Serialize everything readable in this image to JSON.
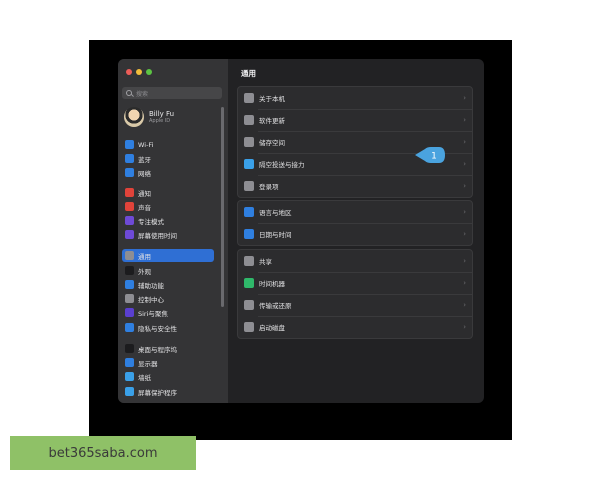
{
  "window": {
    "sidebar": {
      "search_placeholder": "搜索",
      "profile": {
        "name": "Billy Fu",
        "subtitle": "Apple ID"
      },
      "items": [
        {
          "label": "Wi-Fi",
          "icon": "wifi-icon",
          "color": "#2f7fe0"
        },
        {
          "label": "蓝牙",
          "icon": "bluetooth-icon",
          "color": "#2f7fe0"
        },
        {
          "label": "网络",
          "icon": "globe-icon",
          "color": "#2f7fe0"
        },
        {
          "label": "通知",
          "icon": "notification-icon",
          "color": "#e0433a"
        },
        {
          "label": "声音",
          "icon": "speaker-icon",
          "color": "#e0433a"
        },
        {
          "label": "专注模式",
          "icon": "moon-icon",
          "color": "#6e4ad6"
        },
        {
          "label": "屏幕使用时间",
          "icon": "hourglass-icon",
          "color": "#6e4ad6"
        },
        {
          "label": "通用",
          "icon": "gear-icon",
          "color": "#8e8e93",
          "active": true
        },
        {
          "label": "外观",
          "icon": "appearance-icon",
          "color": "#1c1c1e"
        },
        {
          "label": "辅助功能",
          "icon": "accessibility-icon",
          "color": "#2f7fe0"
        },
        {
          "label": "控制中心",
          "icon": "control-center-icon",
          "color": "#8e8e93"
        },
        {
          "label": "Siri与聚焦",
          "icon": "siri-icon",
          "color": "#5a3fd0"
        },
        {
          "label": "隐私与安全性",
          "icon": "hand-icon",
          "color": "#2f7fe0"
        },
        {
          "label": "桌面与程序坞",
          "icon": "dock-icon",
          "color": "#1c1c1e"
        },
        {
          "label": "显示器",
          "icon": "display-icon",
          "color": "#2f7fe0"
        },
        {
          "label": "墙纸",
          "icon": "wallpaper-icon",
          "color": "#3aa0e8"
        },
        {
          "label": "屏幕保护程序",
          "icon": "screensaver-icon",
          "color": "#3aa0e8"
        }
      ]
    },
    "main": {
      "title": "通用",
      "groups": [
        {
          "rows": [
            {
              "label": "关于本机",
              "icon": "laptop-icon",
              "color": "#8e8e93"
            },
            {
              "label": "软件更新",
              "icon": "gear-badge-icon",
              "color": "#8e8e93"
            },
            {
              "label": "储存空间",
              "icon": "disk-icon",
              "color": "#8e8e93"
            },
            {
              "label": "隔空投送与接力",
              "icon": "airdrop-icon",
              "color": "#3aa0e8"
            },
            {
              "label": "登录项",
              "icon": "list-icon",
              "color": "#8e8e93"
            }
          ]
        },
        {
          "rows": [
            {
              "label": "语言与地区",
              "icon": "globe-icon",
              "color": "#2f7fe0"
            },
            {
              "label": "日期与时间",
              "icon": "calendar-icon",
              "color": "#2f7fe0"
            }
          ]
        },
        {
          "rows": [
            {
              "label": "共享",
              "icon": "share-icon",
              "color": "#8e8e93"
            },
            {
              "label": "时间机器",
              "icon": "time-machine-icon",
              "color": "#2fb86a"
            },
            {
              "label": "传输或还原",
              "icon": "transfer-icon",
              "color": "#8e8e93"
            },
            {
              "label": "启动磁盘",
              "icon": "startup-disk-icon",
              "color": "#8e8e93"
            }
          ]
        }
      ],
      "callout_number": "1",
      "callout_color": "#4aa3df"
    }
  },
  "watermark": {
    "text": "bet365saba.com",
    "color": "#8fc167"
  }
}
